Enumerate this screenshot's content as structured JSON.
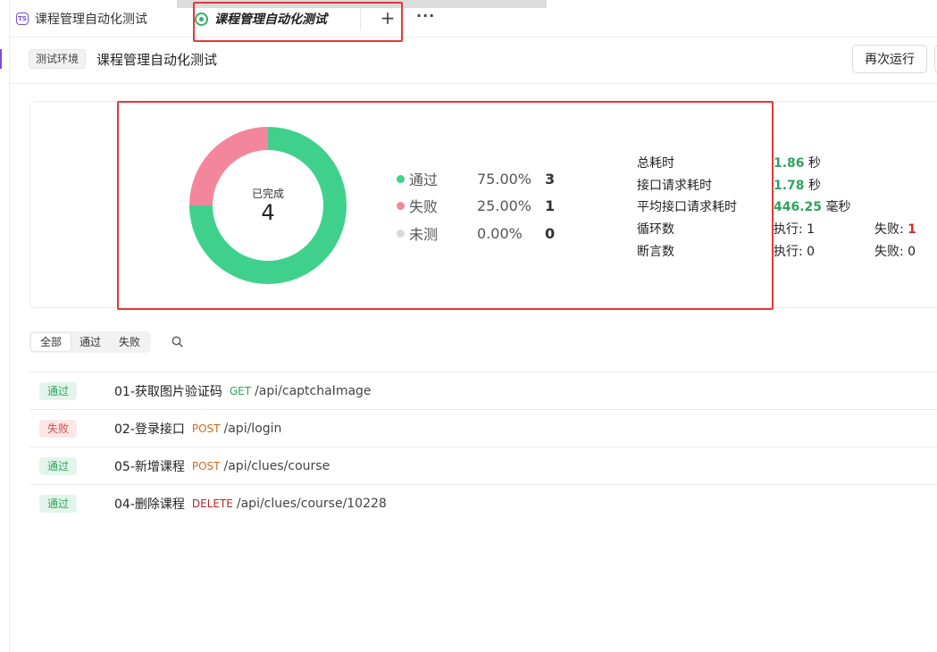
{
  "tabs": [
    {
      "label": "课程管理自动化测试",
      "icon": "test-suite-icon",
      "active": false
    },
    {
      "label": "课程管理自动化测试",
      "icon": "report-icon",
      "active": true
    }
  ],
  "tab_actions": {
    "add": "+",
    "more": "···"
  },
  "header": {
    "env_badge": "测试环境",
    "title": "课程管理自动化测试",
    "rerun_label": "再次运行"
  },
  "summary": {
    "donut": {
      "label": "已完成",
      "total": "4",
      "pass_fraction": 0.75,
      "fail_fraction": 0.25,
      "pass_color": "#3fd18c",
      "fail_color": "#f4869b"
    },
    "stats": [
      {
        "label": "通过",
        "percent": "75.00%",
        "count": "3",
        "color": "#3fd18c"
      },
      {
        "label": "失败",
        "percent": "25.00%",
        "count": "1",
        "color": "#f4869b"
      },
      {
        "label": "未测",
        "percent": "0.00%",
        "count": "0",
        "color": "#d9d9d9"
      }
    ],
    "metrics": {
      "total_time_label": "总耗时",
      "total_time_value": "1.86",
      "total_time_unit": "秒",
      "api_time_label": "接口请求耗时",
      "api_time_value": "1.78",
      "api_time_unit": "秒",
      "avg_api_time_label": "平均接口请求耗时",
      "avg_api_time_value": "446.25",
      "avg_api_time_unit": "毫秒",
      "loop_label": "循环数",
      "loop_exec": "执行: 1",
      "loop_fail_prefix": "失败:",
      "loop_fail_value": "1",
      "assert_label": "断言数",
      "assert_exec": "执行: 0",
      "assert_fail": "失败: 0"
    }
  },
  "filter": {
    "all": "全部",
    "pass": "通过",
    "fail": "失败"
  },
  "results": [
    {
      "status": "通过",
      "type": "pass",
      "name": "01-获取图片验证码",
      "method": "GET",
      "path": "/api/captchaImage"
    },
    {
      "status": "失败",
      "type": "fail",
      "name": "02-登录接口",
      "method": "POST",
      "path": "/api/login"
    },
    {
      "status": "通过",
      "type": "pass",
      "name": "05-新增课程",
      "method": "POST",
      "path": "/api/clues/course"
    },
    {
      "status": "通过",
      "type": "pass",
      "name": "04-删除课程",
      "method": "DELETE",
      "path": "/api/clues/course/10228"
    }
  ]
}
